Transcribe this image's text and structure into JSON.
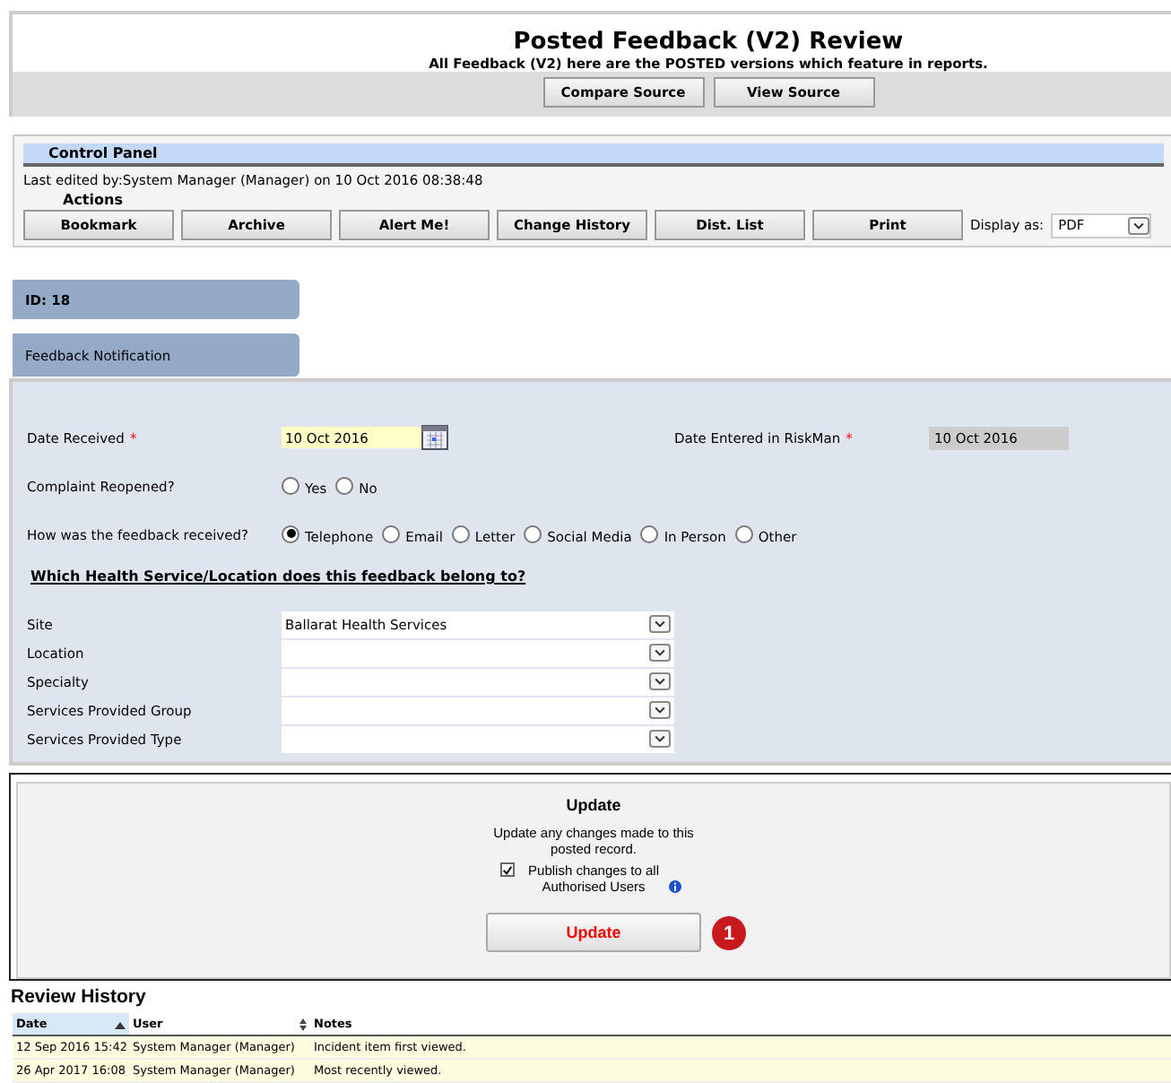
{
  "header": {
    "title": "Posted Feedback (V2) Review",
    "subtitle": "All Feedback (V2) here are the POSTED versions which feature in reports.",
    "buttons": [
      "Compare Source",
      "View Source"
    ]
  },
  "control_panel": {
    "title": "Control Panel",
    "last_edited": "Last edited by:System Manager (Manager) on 10 Oct 2016 08:38:48",
    "actions_label": "Actions",
    "actions": [
      "Bookmark",
      "Archive",
      "Alert Me!",
      "Change History",
      "Dist. List",
      "Print"
    ],
    "display_label": "Display as:",
    "display_value": "PDF"
  },
  "tabs": [
    {
      "label": "ID: 18",
      "kind": "id"
    },
    {
      "label": "Feedback Notification",
      "kind": "section"
    }
  ],
  "form": {
    "date_received": {
      "label": "Date Received",
      "required_mark": "*",
      "value": "10 Oct 2016"
    },
    "date_entered": {
      "label": "Date Entered in RiskMan",
      "required_mark": "*",
      "value": "10 Oct 2016"
    },
    "reopened": {
      "label": "Complaint Reopened?",
      "options": [
        {
          "label": "Yes",
          "selected": false
        },
        {
          "label": "No",
          "selected": false
        }
      ]
    },
    "received_via": {
      "label": "How was the feedback received?",
      "options": [
        {
          "label": "Telephone",
          "selected": true
        },
        {
          "label": "Email",
          "selected": false
        },
        {
          "label": "Letter",
          "selected": false
        },
        {
          "label": "Social Media",
          "selected": false
        },
        {
          "label": "In Person",
          "selected": false
        },
        {
          "label": "Other",
          "selected": false
        }
      ]
    },
    "section_heading": "Which Health Service/Location does this feedback belong to?",
    "selects": [
      {
        "label": "Site",
        "value": "Ballarat Health Services"
      },
      {
        "label": "Location"
      },
      {
        "label": "Specialty"
      },
      {
        "label": "Services Provided Group"
      },
      {
        "label": "Services Provided Type"
      }
    ]
  },
  "update": {
    "title": "Update",
    "description": "Update any changes made to this posted record.",
    "publish": {
      "label": "Publish changes to all Authorised Users",
      "checked": true
    },
    "button": "Update",
    "badge": "1"
  },
  "review_history": {
    "title": "Review History",
    "columns": [
      {
        "label": "Date",
        "kind": "sorted"
      },
      {
        "label": "User",
        "kind": "sortable"
      },
      {
        "label": "Notes",
        "kind": "plain"
      }
    ],
    "rows": [
      [
        "12 Sep 2016 15:42",
        "System Manager (Manager)",
        "Incident item first viewed."
      ],
      [
        "26 Apr 2017 16:08",
        "System Manager (Manager)",
        "Most recently viewed."
      ]
    ]
  }
}
